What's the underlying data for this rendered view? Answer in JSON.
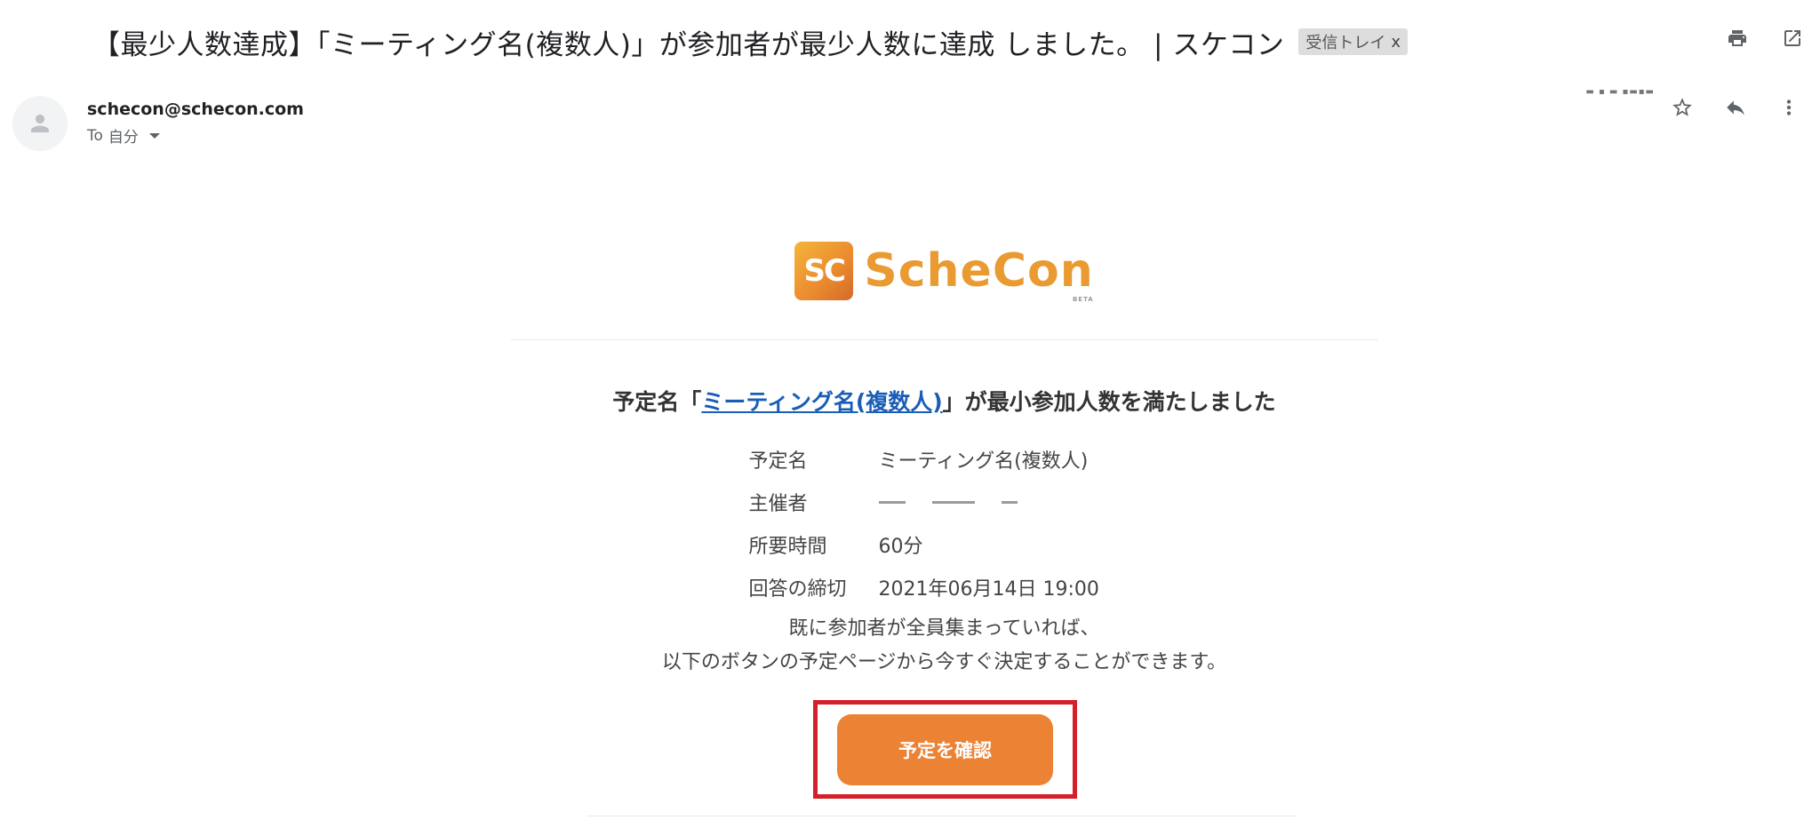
{
  "email": {
    "subject": "【最少人数達成】「ミーティング名(複数人)」が参加者が最少人数に達成 しました。 | スケコン",
    "label_chip": "受信トレイ",
    "label_chip_close": "x",
    "sender": "schecon@schecon.com",
    "recipient_prefix": "To",
    "recipient": "自分"
  },
  "body": {
    "logo_text": "ScheCon",
    "logo_mark": "SC",
    "logo_sub": "BETA",
    "headline_prefix": "予定名「",
    "headline_link": "ミーティング名(複数人)",
    "headline_suffix": "」が最小参加人数を満たしました",
    "details": [
      {
        "label": "予定名",
        "value": "ミーティング名(複数人)"
      },
      {
        "label": "主催者",
        "value": ""
      },
      {
        "label": "所要時間",
        "value": "60分"
      },
      {
        "label": "回答の締切",
        "value": "2021年06月14日 19:00"
      }
    ],
    "note_line1": "既に参加者が全員集まっていれば、",
    "note_line2": "以下のボタンの予定ページから今すぐ決定することができます。",
    "button_label": "予定を確認"
  },
  "colors": {
    "accent_orange": "#ec8234",
    "link_blue": "#1a5db7",
    "highlight_red": "#d42029"
  },
  "icons": [
    "print-icon",
    "open-new-window-icon",
    "avatar-person-icon",
    "star-icon",
    "reply-icon",
    "more-vert-icon",
    "dropdown-caret-icon"
  ]
}
